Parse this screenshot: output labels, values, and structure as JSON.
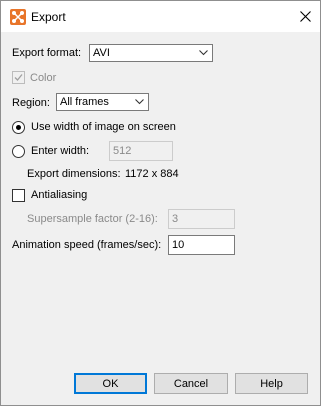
{
  "window": {
    "title": "Export"
  },
  "export_format": {
    "label": "Export format:",
    "selected": "AVI"
  },
  "color": {
    "label": "Color",
    "checked": true,
    "enabled": false
  },
  "region": {
    "label": "Region:",
    "selected": "All frames"
  },
  "width_mode": {
    "use_screen_width_label": "Use width of image on screen",
    "enter_width_label": "Enter width:",
    "selected": "use_screen_width"
  },
  "enter_width": {
    "value": "512",
    "enabled": false
  },
  "export_dimensions": {
    "label": "Export dimensions:",
    "value": "1172 x 884"
  },
  "antialiasing": {
    "label": "Antialiasing",
    "checked": false
  },
  "supersample": {
    "label": "Supersample factor (2-16):",
    "value": "3",
    "enabled": false
  },
  "animation_speed": {
    "label": "Animation speed (frames/sec):",
    "value": "10"
  },
  "buttons": {
    "ok": "OK",
    "cancel": "Cancel",
    "help": "Help"
  },
  "colors": {
    "accent": "#0078d7",
    "dialog_bg": "#f0f0f0",
    "app_icon": "#e8752a"
  },
  "icons": {
    "app": "export-app-icon",
    "close": "close-icon",
    "dropdown": "chevron-down-icon",
    "check": "checkmark-icon"
  }
}
